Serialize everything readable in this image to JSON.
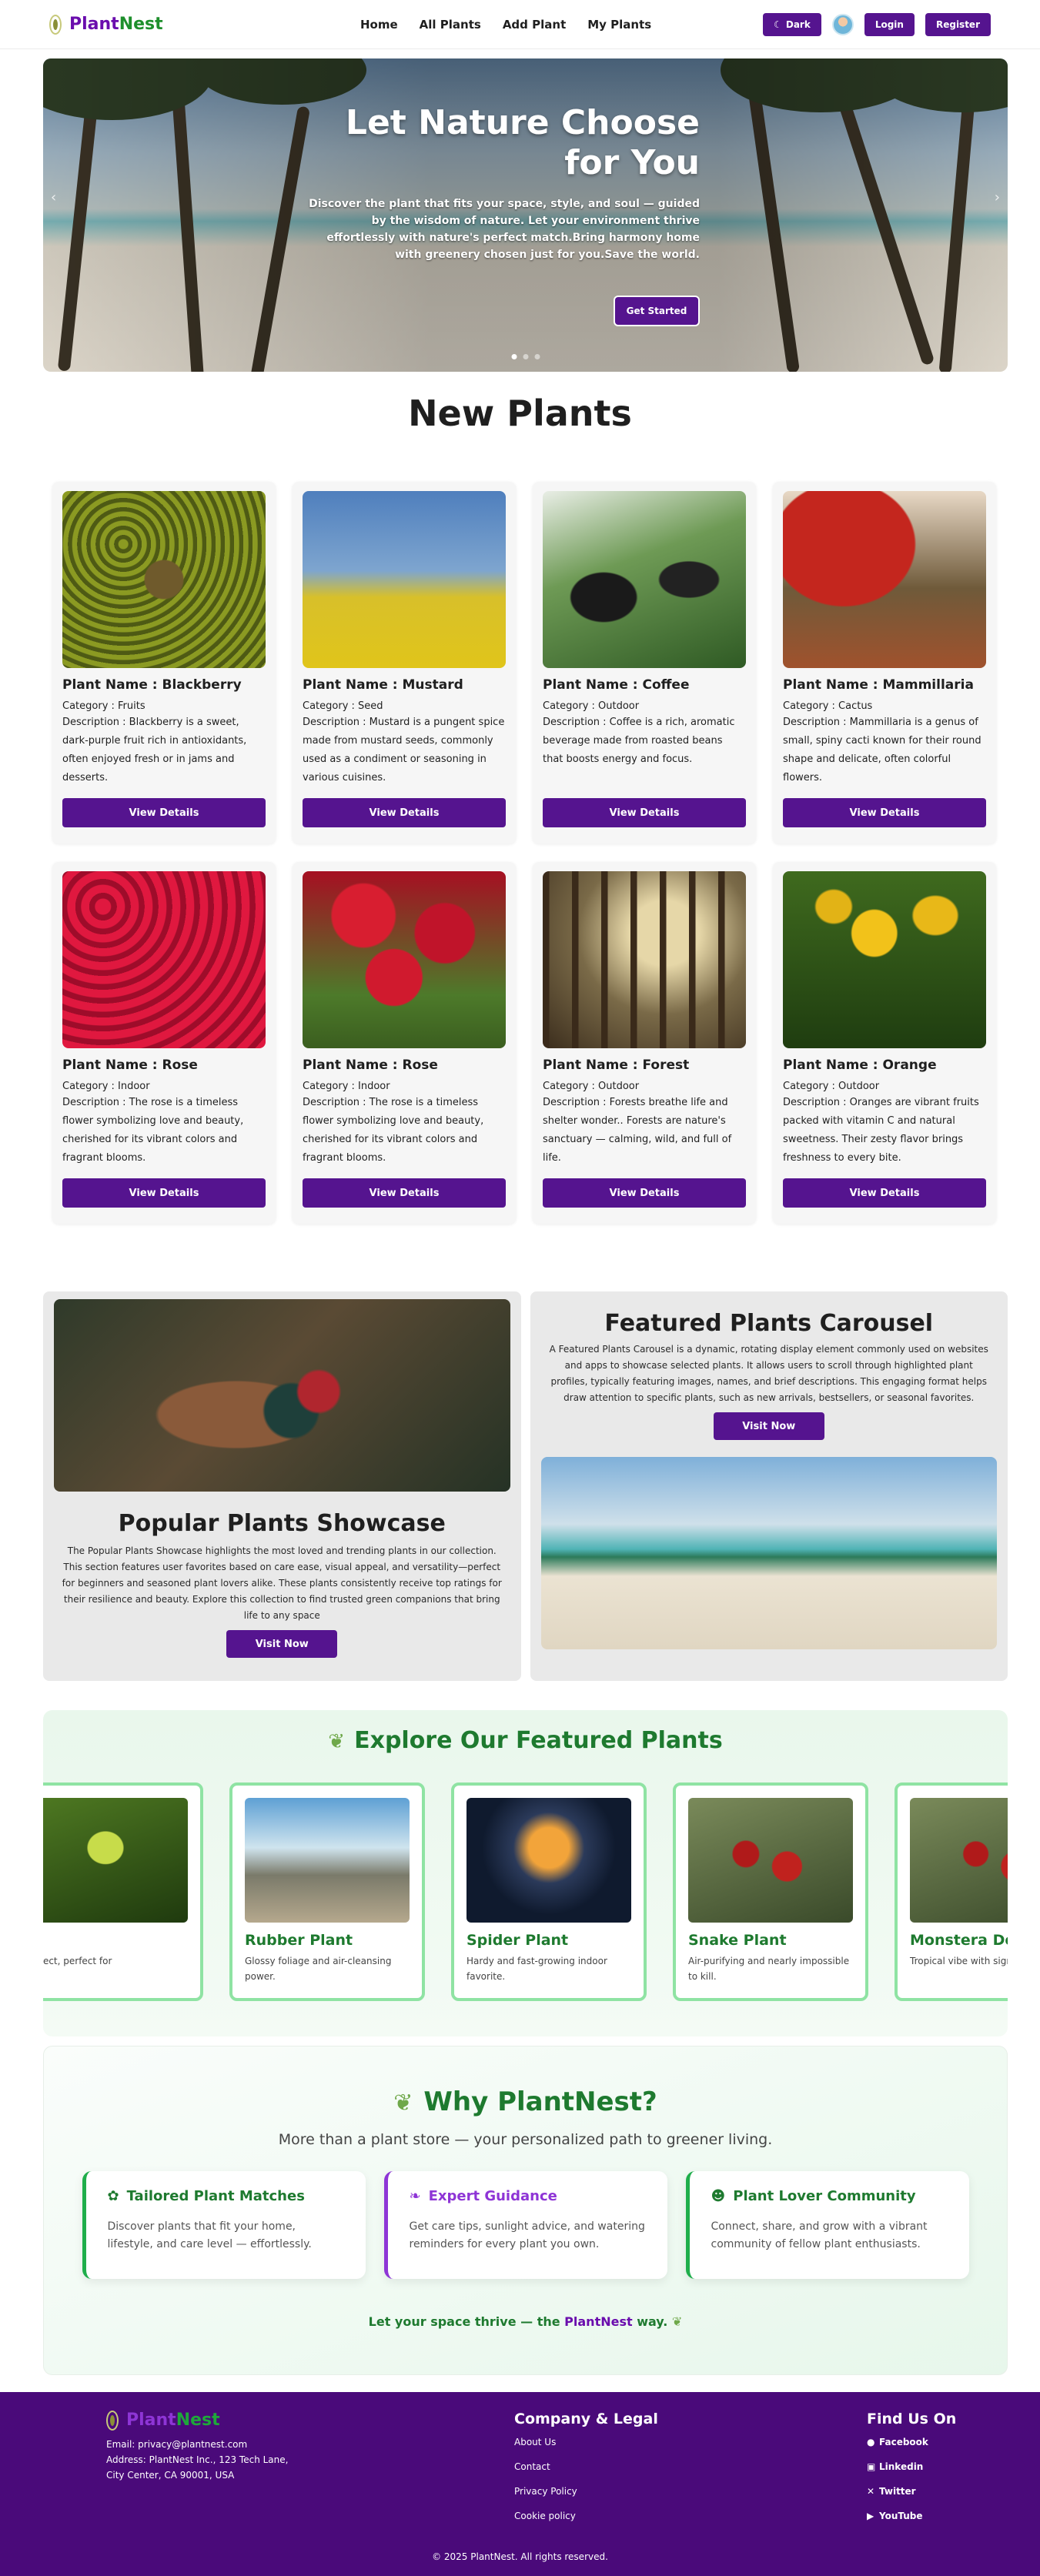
{
  "brand": {
    "part1": "Plant",
    "part2": "Nest"
  },
  "nav": {
    "links": [
      "Home",
      "All Plants",
      "Add Plant",
      "My Plants"
    ],
    "dark": "Dark",
    "login": "Login",
    "register": "Register"
  },
  "hero": {
    "title": "Let Nature Choose for You",
    "text": "Discover the plant that fits your space, style, and soul — guided by the wisdom of nature. Let your environment thrive effortlessly with nature's perfect match.Bring harmony home with greenery chosen just for you.Save the world.",
    "button": "Get Started"
  },
  "new_plants": {
    "title": "New Plants",
    "view_label": "View Details",
    "items": [
      {
        "name": "Plant Name : Blackberry",
        "category": "Category : Fruits",
        "description": "Description : Blackberry is a sweet, dark-purple fruit rich in antioxidants, often enjoyed fresh or in jams and desserts."
      },
      {
        "name": "Plant Name : Mustard",
        "category": "Category : Seed",
        "description": "Description : Mustard is a pungent spice made from mustard seeds, commonly used as a condiment or seasoning in various cuisines."
      },
      {
        "name": "Plant Name : Coffee",
        "category": "Category : Outdoor",
        "description": "Description : Coffee is a rich, aromatic beverage made from roasted beans that boosts energy and focus."
      },
      {
        "name": "Plant Name : Mammillaria",
        "category": "Category : Cactus",
        "description": "Description : Mammillaria is a genus of small, spiny cacti known for their round shape and delicate, often colorful flowers."
      },
      {
        "name": "Plant Name : Rose",
        "category": "Category : Indoor",
        "description": "Description : The rose is a timeless flower symbolizing love and beauty, cherished for its vibrant colors and fragrant blooms."
      },
      {
        "name": "Plant Name : Rose",
        "category": "Category : Indoor",
        "description": "Description : The rose is a timeless flower symbolizing love and beauty, cherished for its vibrant colors and fragrant blooms."
      },
      {
        "name": "Plant Name : Forest",
        "category": "Category : Outdoor",
        "description": "Description : Forests breathe life and shelter wonder.. Forests are nature's sanctuary — calming, wild, and full of life."
      },
      {
        "name": "Plant Name : Orange",
        "category": "Category : Outdoor",
        "description": "Description : Oranges are vibrant fruits packed with vitamin C and natural sweetness. Their zesty flavor brings freshness to every bite."
      }
    ]
  },
  "showcase": {
    "popular_title": "Popular Plants Showcase",
    "popular_text": "The Popular Plants Showcase highlights the most loved and trending plants in our collection. This section features user favorites based on care ease, visual appeal, and versatility—perfect for beginners and seasoned plant lovers alike. These plants consistently receive top ratings for their resilience and beauty. Explore this collection to find trusted green companions that bring life to any space",
    "carousel_title": "Featured Plants Carousel",
    "carousel_text": "A Featured Plants Carousel is a dynamic, rotating display element commonly used on websites and apps to showcase selected plants. It allows users to scroll through highlighted plant profiles, typically featuring images, names, and brief descriptions. This engaging format helps draw attention to specific plants, such as new arrivals, bestsellers, or seasonal favorites.",
    "visit": "Visit Now"
  },
  "featured": {
    "title": "Explore Our Featured Plants",
    "items": [
      {
        "name": "t",
        "text": "neglect, perfect for"
      },
      {
        "name": "Rubber Plant",
        "text": "Glossy foliage and air-cleansing power."
      },
      {
        "name": "Spider Plant",
        "text": "Hardy and fast-growing indoor favorite."
      },
      {
        "name": "Snake Plant",
        "text": "Air-purifying and nearly impossible to kill."
      },
      {
        "name": "Monstera Deliciosa",
        "text": "Tropical vibe with signature leaves."
      }
    ]
  },
  "why": {
    "title": "Why PlantNest?",
    "subtitle": "More than a plant store — your personalized path to greener living.",
    "cards": [
      {
        "title": "Tailored Plant Matches",
        "text": "Discover plants that fit your home, lifestyle, and care level — effortlessly."
      },
      {
        "title": "Expert Guidance",
        "text": "Get care tips, sunlight advice, and watering reminders for every plant you own."
      },
      {
        "title": "Plant Lover Community",
        "text": "Connect, share, and grow with a vibrant community of fellow plant enthusiasts."
      }
    ],
    "tag_before": "Let your space thrive — the ",
    "tag_brand": "PlantNest",
    "tag_after": " way."
  },
  "footer": {
    "email": "Email: privacy@plantnest.com",
    "address": "Address: PlantNest Inc., 123 Tech Lane, City Center, CA 90001, USA",
    "company_title": "Company & Legal",
    "company_links": [
      "About Us",
      "Contact",
      "Privacy Policy",
      "Cookie policy"
    ],
    "find_title": "Find Us On",
    "social": [
      "Facebook",
      "Linkedin",
      "Twitter",
      "YouTube"
    ],
    "copyright": "© 2025 PlantNest. All rights reserved."
  }
}
